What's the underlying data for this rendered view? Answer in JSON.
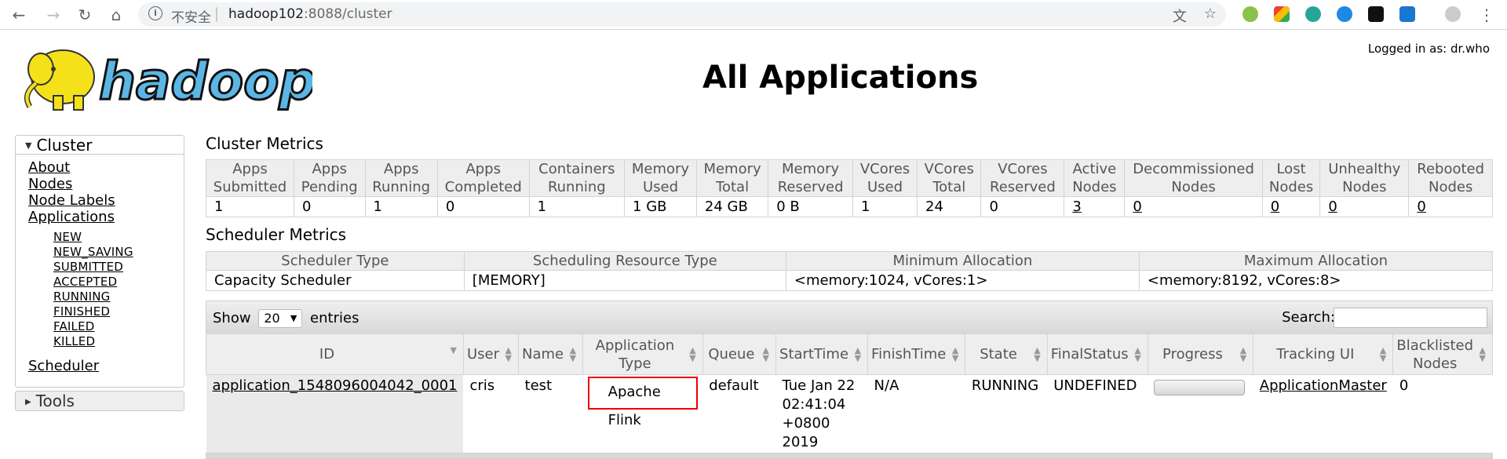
{
  "browser": {
    "security_label": "不安全",
    "url_host": "hadoop102",
    "url_rest": ":8088/cluster"
  },
  "header": {
    "logged_in": "Logged in as: dr.who",
    "title": "All Applications",
    "logo_text": "hadoop"
  },
  "sidebar": {
    "cluster_label": "Cluster",
    "links": [
      "About",
      "Nodes",
      "Node Labels",
      "Applications"
    ],
    "app_states": [
      "NEW",
      "NEW_SAVING",
      "SUBMITTED",
      "ACCEPTED",
      "RUNNING",
      "FINISHED",
      "FAILED",
      "KILLED"
    ],
    "scheduler": "Scheduler",
    "tools_label": "Tools"
  },
  "cluster_metrics": {
    "title": "Cluster Metrics",
    "headers": [
      "Apps Submitted",
      "Apps Pending",
      "Apps Running",
      "Apps Completed",
      "Containers Running",
      "Memory Used",
      "Memory Total",
      "Memory Reserved",
      "VCores Used",
      "VCores Total",
      "VCores Reserved",
      "Active Nodes",
      "Decommissioned Nodes",
      "Lost Nodes",
      "Unhealthy Nodes",
      "Rebooted Nodes"
    ],
    "values": [
      "1",
      "0",
      "1",
      "0",
      "1",
      "1 GB",
      "24 GB",
      "0 B",
      "1",
      "24",
      "0",
      "3",
      "0",
      "0",
      "0",
      "0"
    ]
  },
  "scheduler_metrics": {
    "title": "Scheduler Metrics",
    "headers": [
      "Scheduler Type",
      "Scheduling Resource Type",
      "Minimum Allocation",
      "Maximum Allocation"
    ],
    "values": [
      "Capacity Scheduler",
      "[MEMORY]",
      "<memory:1024, vCores:1>",
      "<memory:8192, vCores:8>"
    ]
  },
  "datatable": {
    "show_label": "Show",
    "page_size": "20",
    "entries_label": "entries",
    "search_label": "Search:"
  },
  "apps_table": {
    "headers": [
      "ID",
      "User",
      "Name",
      "Application Type",
      "Queue",
      "StartTime",
      "FinishTime",
      "State",
      "FinalStatus",
      "Progress",
      "Tracking UI",
      "Blacklisted Nodes"
    ],
    "row": {
      "id": "application_1548096004042_0001",
      "user": "cris",
      "name": "test",
      "type": "Apache Flink",
      "queue": "default",
      "start_time": "Tue Jan 22 02:41:04 +0800 2019",
      "finish_time": "N/A",
      "state": "RUNNING",
      "final_status": "UNDEFINED",
      "progress": 0,
      "tracking_ui": "ApplicationMaster",
      "blacklisted": "0"
    }
  }
}
